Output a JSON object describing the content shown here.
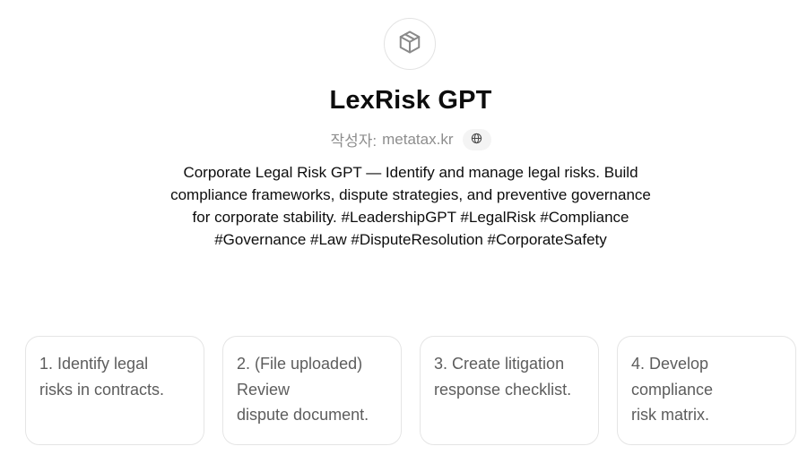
{
  "gpt": {
    "avatar_icon": "cube-icon",
    "title": "LexRisk GPT",
    "author_prefix": "작성자:",
    "author_name": "metatax.kr",
    "website_icon": "globe-icon",
    "description": "Corporate Legal Risk GPT — Identify and manage legal risks. Build compliance frameworks, dispute strategies, and preventive governance for corporate stability. #LeadershipGPT #LegalRisk #Compliance #Governance #Law #DisputeResolution #CorporateSafety"
  },
  "starters": [
    {
      "label": "1. Identify legal\nrisks in contracts."
    },
    {
      "label": "2. (File uploaded)\nReview\ndispute document."
    },
    {
      "label": "3. Create litigation\nresponse checklist."
    },
    {
      "label": "4. Develop\ncompliance\nrisk matrix."
    }
  ]
}
